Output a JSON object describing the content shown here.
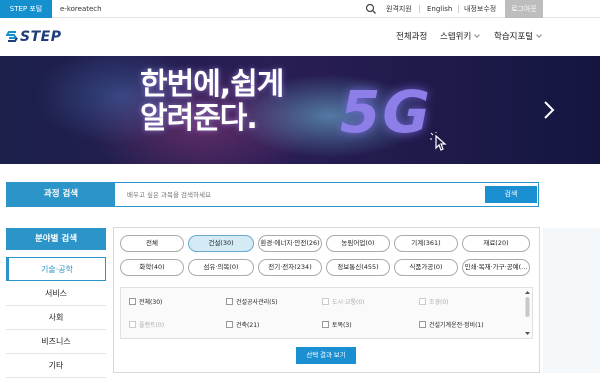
{
  "topbar": {
    "tab_step": "STEP 포털",
    "tab_ekorea": "e-koreatech",
    "links": [
      "원격지원",
      "English",
      "내정보수정"
    ],
    "login": "로그아웃"
  },
  "header": {
    "logo": "STEP",
    "nav": [
      "전체과정",
      "스텝위키",
      "학습지포털"
    ]
  },
  "banner": {
    "line1": "한번에,쉽게",
    "line2": "알려준다.",
    "badge": "5G"
  },
  "search": {
    "label": "과정 검색",
    "placeholder": "배우고 싶은 과목을 검색하세요",
    "button": "검색"
  },
  "sidebar": {
    "title": "분야별 검색",
    "items": [
      "기술·공학",
      "서비스",
      "사회",
      "비즈니스",
      "기타"
    ]
  },
  "categories": {
    "row1": [
      "전체",
      "건설(30)",
      "환경·에너지·안전(26)",
      "농림어업(0)",
      "기계(361)",
      "재료(20)"
    ],
    "row2": [
      "화학(40)",
      "섬유·의복(0)",
      "전기·전자(234)",
      "정보통신(455)",
      "식품가공(0)",
      "인쇄·목재·가구·공예(..."
    ]
  },
  "subcategories": {
    "row1": [
      "전체(30)",
      "건설공사관리(5)",
      "도시·교통(0)",
      "조경(0)"
    ],
    "row2": [
      "플랜트(0)",
      "건축(21)",
      "토목(3)",
      "건설기계운전·정비(1)"
    ]
  },
  "result_button": "선택 결과 보기",
  "colors": {
    "accent": "#2b95c9",
    "button": "#1a8fd2"
  }
}
